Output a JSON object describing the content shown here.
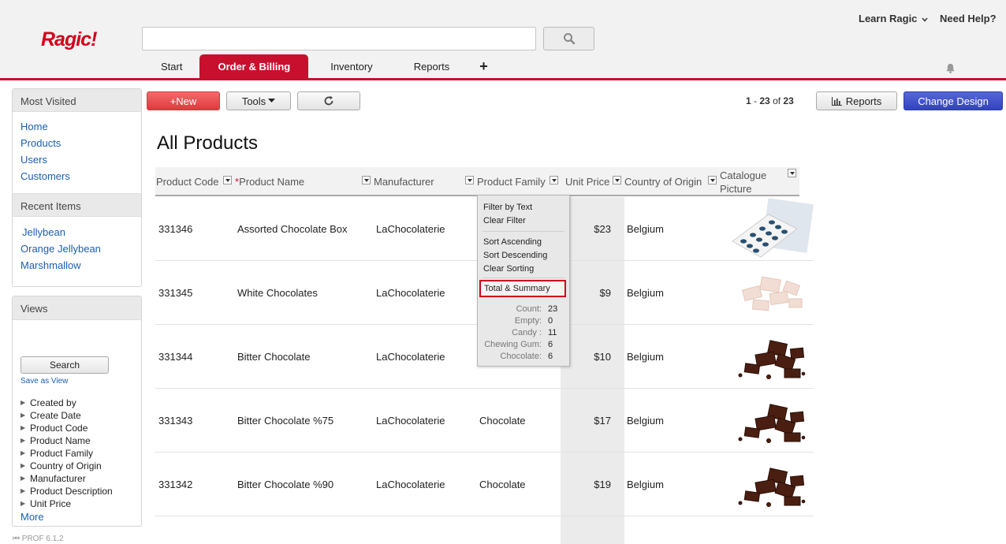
{
  "header": {
    "logo": "Ragic!",
    "learn_link": "Learn Ragic",
    "help_link": "Need Help?",
    "search_value": "",
    "tabs": [
      {
        "label": "Start",
        "active": false
      },
      {
        "label": "Order & Billing",
        "active": true
      },
      {
        "label": "Inventory",
        "active": false
      },
      {
        "label": "Reports",
        "active": false
      },
      {
        "label": "+",
        "active": false
      }
    ]
  },
  "sidebar": {
    "most_visited": {
      "title": "Most Visited",
      "items": [
        "Home",
        "Products",
        "Users",
        "Customers"
      ]
    },
    "recent": {
      "title": "Recent Items",
      "items": [
        "Jellybean",
        "Orange Jellybean",
        "Marshmallow"
      ]
    },
    "views": {
      "title": "Views",
      "search_label": "Search",
      "save_label": "Save as View",
      "fields": [
        "Created by",
        "Create Date",
        "Product Code",
        "Product Name",
        "Product Family",
        "Country of Origin",
        "Manufacturer",
        "Product Description",
        "Unit Price"
      ],
      "more": "More"
    },
    "version": "PROF 6.1.2"
  },
  "toolbar": {
    "new_label": "+New",
    "tools_label": "Tools",
    "reports_label": "Reports",
    "design_label": "Change Design",
    "pager": {
      "from": "1",
      "to": "23",
      "of_label": "of",
      "total": "23"
    }
  },
  "page_title": "All Products",
  "table": {
    "columns": [
      "Product Code",
      "Product Name",
      "Manufacturer",
      "Product Family",
      "Unit Price",
      "Country of Origin",
      "Catalogue Picture"
    ],
    "rows": [
      {
        "code": "331346",
        "name": "Assorted Chocolate Box",
        "manufacturer": "LaChocolaterie",
        "family": "",
        "price": "$23",
        "country": "Belgium",
        "pic": "box"
      },
      {
        "code": "331345",
        "name": "White Chocolates",
        "manufacturer": "LaChocolaterie",
        "family": "",
        "price": "$9",
        "country": "Belgium",
        "pic": "white"
      },
      {
        "code": "331344",
        "name": "Bitter Chocolate",
        "manufacturer": "LaChocolaterie",
        "family": "",
        "price": "$10",
        "country": "Belgium",
        "pic": "dark"
      },
      {
        "code": "331343",
        "name": "Bitter Chocolate %75",
        "manufacturer": "LaChocolaterie",
        "family": "Chocolate",
        "price": "$17",
        "country": "Belgium",
        "pic": "dark"
      },
      {
        "code": "331342",
        "name": "Bitter Chocolate %90",
        "manufacturer": "LaChocolaterie",
        "family": "Chocolate",
        "price": "$19",
        "country": "Belgium",
        "pic": "dark"
      }
    ]
  },
  "column_menu": {
    "filter_text": "Filter by Text",
    "clear_filter": "Clear Filter",
    "sort_asc": "Sort Ascending",
    "sort_desc": "Sort Descending",
    "clear_sort": "Clear Sorting",
    "total_summary": "Total & Summary",
    "summary": [
      {
        "label": "Count:",
        "value": "23"
      },
      {
        "label": "Empty:",
        "value": "0"
      },
      {
        "label": "Candy :",
        "value": "11"
      },
      {
        "label": "Chewing Gum:",
        "value": "6"
      },
      {
        "label": "Chocolate:",
        "value": "6"
      }
    ]
  },
  "colors": {
    "brand_red": "#c8102e",
    "design_blue": "#3343c0",
    "link_blue": "#1a5fb4"
  }
}
